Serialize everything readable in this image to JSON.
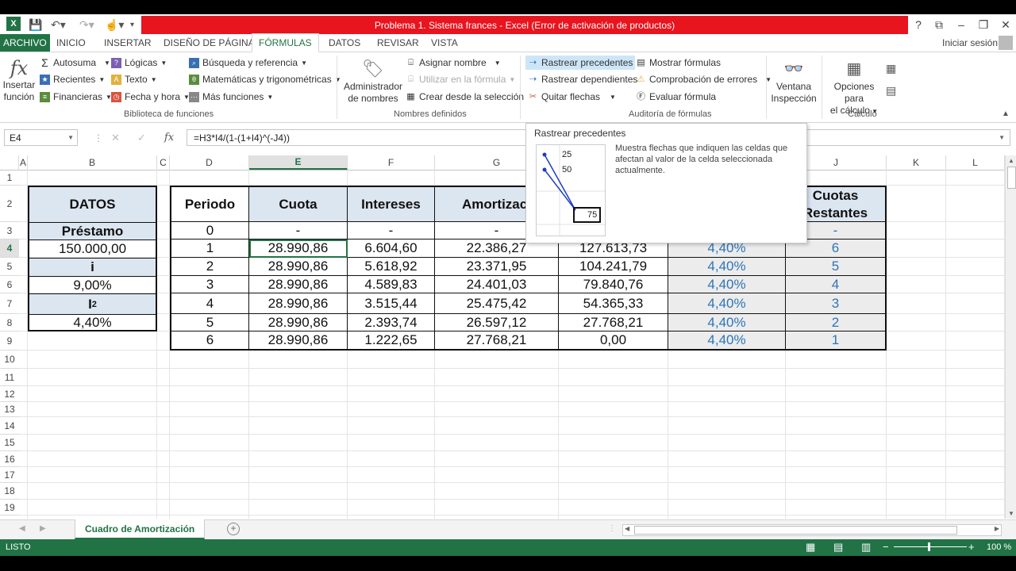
{
  "window": {
    "title": "Problema 1. Sistema frances -  Excel (Error de activación de productos)",
    "help": "?",
    "restore_ribbon": "⧉",
    "minimize": "–",
    "maximize": "❐",
    "close": "✕"
  },
  "tabs": {
    "file": "ARCHIVO",
    "home": "INICIO",
    "insert": "INSERTAR",
    "page_layout": "DISEÑO DE PÁGINA",
    "formulas": "FÓRMULAS",
    "data": "DATOS",
    "review": "REVISAR",
    "view": "VISTA",
    "sign_in": "Iniciar sesión"
  },
  "ribbon": {
    "insert_function": [
      "Insertar",
      "función"
    ],
    "autosum": "Autosuma",
    "recent": "Recientes",
    "financial": "Financieras",
    "logical": "Lógicas",
    "text": "Texto",
    "date_time": "Fecha y hora",
    "lookup": "Búsqueda y referencia",
    "math": "Matemáticas y trigonométricas",
    "more_functions": "Más funciones",
    "group_library": "Biblioteca de funciones",
    "name_manager": [
      "Administrador",
      "de nombres"
    ],
    "define_name": "Asignar nombre",
    "use_in_formula": "Utilizar en la fórmula",
    "create_from_selection": "Crear desde la selección",
    "group_names": "Nombres definidos",
    "trace_precedents": "Rastrear precedentes",
    "trace_dependents": "Rastrear dependientes",
    "remove_arrows": "Quitar flechas",
    "show_formulas": "Mostrar fórmulas",
    "error_checking": "Comprobación de errores",
    "evaluate_formula": "Evaluar fórmula",
    "group_audit": "Auditoría de fórmulas",
    "watch_window": [
      "Ventana",
      "Inspección"
    ],
    "calc_options": [
      "Opciones para",
      "el cálculo"
    ],
    "group_calc": "Cálculo"
  },
  "formula_bar": {
    "name_box": "E4",
    "fx": "fx",
    "cancel": "✕",
    "enter": "✓",
    "formula": "=H3*I4/(1-(1+I4)^(-J4))"
  },
  "columns": [
    "A",
    "B",
    "C",
    "D",
    "E",
    "F",
    "G",
    "H",
    "I",
    "J",
    "K",
    "L"
  ],
  "selected_column": "E",
  "rows": [
    "1",
    "2",
    "3",
    "4",
    "5",
    "6",
    "7",
    "8",
    "9",
    "10",
    "11",
    "12",
    "13",
    "14",
    "15",
    "16",
    "17",
    "18",
    "19"
  ],
  "selected_row": "4",
  "datos": {
    "title": "DATOS",
    "prestamo_label": "Préstamo",
    "prestamo_value": "150.000,00",
    "i_label": "i",
    "i_value": "9,00%",
    "i2_label": "I",
    "i2_sub": "2",
    "i2_value": "4,40%"
  },
  "table": {
    "headers": [
      "Periodo",
      "Cuota",
      "Intereses",
      "Amortizaci",
      "",
      "",
      "Cuotas Restantes"
    ],
    "header_j": [
      "Cuotas",
      "Restantes"
    ],
    "rows": [
      [
        "0",
        "-",
        "-",
        "-",
        "",
        "",
        "-"
      ],
      [
        "1",
        "28.990,86",
        "6.604,60",
        "22.386,27",
        "127.613,73",
        "4,40%",
        "6"
      ],
      [
        "2",
        "28.990,86",
        "5.618,92",
        "23.371,95",
        "104.241,79",
        "4,40%",
        "5"
      ],
      [
        "3",
        "28.990,86",
        "4.589,83",
        "24.401,03",
        "79.840,76",
        "4,40%",
        "4"
      ],
      [
        "4",
        "28.990,86",
        "3.515,44",
        "25.475,42",
        "54.365,33",
        "4,40%",
        "3"
      ],
      [
        "5",
        "28.990,86",
        "2.393,74",
        "26.597,12",
        "27.768,21",
        "4,40%",
        "2"
      ],
      [
        "6",
        "28.990,86",
        "1.222,65",
        "27.768,21",
        "0,00",
        "4,40%",
        "1"
      ]
    ]
  },
  "tooltip": {
    "title": "Rastrear precedentes",
    "body": "Muestra flechas que indiquen las celdas que afectan al valor de la celda seleccionada actualmente.",
    "v1": "25",
    "v2": "50",
    "v3": "75"
  },
  "sheet_tab": "Cuadro de Amortización",
  "status": {
    "mode": "LISTO",
    "zoom": "100 %",
    "zoom_minus": "−",
    "zoom_plus": "+"
  },
  "colors": {
    "excel_green": "#217346",
    "title_red": "#e8141e",
    "header_blue": "#dce6f1"
  }
}
